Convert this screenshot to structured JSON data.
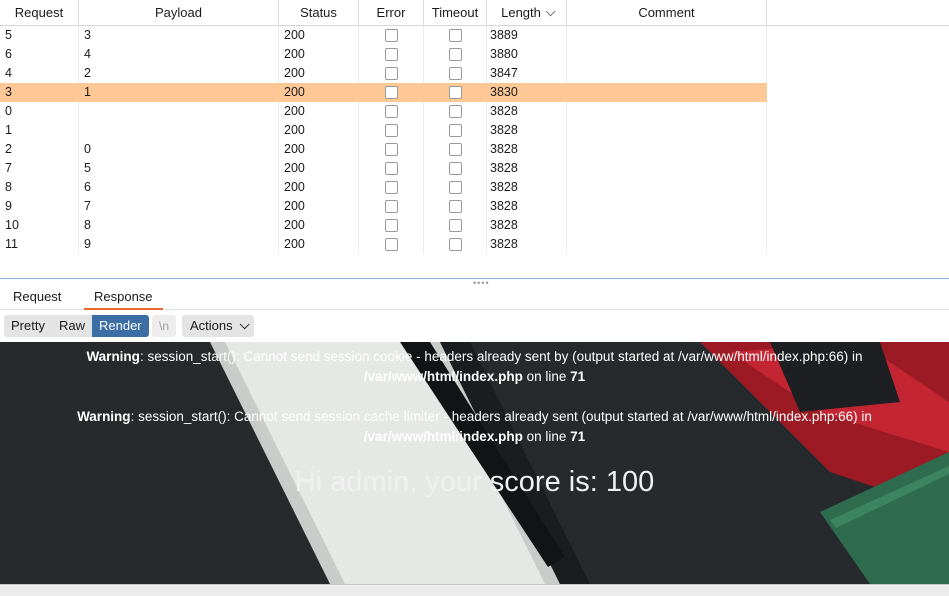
{
  "table": {
    "headers": {
      "request": "Request",
      "payload": "Payload",
      "status": "Status",
      "error": "Error",
      "timeout": "Timeout",
      "length": "Length",
      "comment": "Comment"
    },
    "rows": [
      {
        "request": "5",
        "payload": "3",
        "status": "200",
        "length": "3889",
        "selected": false
      },
      {
        "request": "6",
        "payload": "4",
        "status": "200",
        "length": "3880",
        "selected": false
      },
      {
        "request": "4",
        "payload": "2",
        "status": "200",
        "length": "3847",
        "selected": false
      },
      {
        "request": "3",
        "payload": "1",
        "status": "200",
        "length": "3830",
        "selected": true
      },
      {
        "request": "0",
        "payload": "",
        "status": "200",
        "length": "3828",
        "selected": false
      },
      {
        "request": "1",
        "payload": "",
        "status": "200",
        "length": "3828",
        "selected": false
      },
      {
        "request": "2",
        "payload": "0",
        "status": "200",
        "length": "3828",
        "selected": false
      },
      {
        "request": "7",
        "payload": "5",
        "status": "200",
        "length": "3828",
        "selected": false
      },
      {
        "request": "8",
        "payload": "6",
        "status": "200",
        "length": "3828",
        "selected": false
      },
      {
        "request": "9",
        "payload": "7",
        "status": "200",
        "length": "3828",
        "selected": false
      },
      {
        "request": "10",
        "payload": "8",
        "status": "200",
        "length": "3828",
        "selected": false
      },
      {
        "request": "11",
        "payload": "9",
        "status": "200",
        "length": "3828",
        "selected": false
      }
    ],
    "selected_color": "#fec796"
  },
  "tabs": {
    "request": "Request",
    "response": "Response",
    "active": "Response"
  },
  "toolbar": {
    "pretty": "Pretty",
    "raw": "Raw",
    "render": "Render",
    "newline": "\\n",
    "actions": "Actions",
    "active": "Render",
    "accent": "#3a6ea5"
  },
  "render": {
    "warning1": {
      "label": "Warning",
      "text": ": session_start(): Cannot send session cookie - headers already sent by (output started at /var/www/html/index.php:66) in",
      "file": "/var/www/html/index.php",
      "on_line": "on line",
      "line": "71"
    },
    "warning2": {
      "label": "Warning",
      "text": ": session_start(): Cannot send session cache limiter - headers already sent (output started at /var/www/html/index.php:66) in",
      "file": "/var/www/html/index.php",
      "on_line": "on line",
      "line": "71"
    },
    "greeting": "Hi admin, your score is: 100"
  }
}
